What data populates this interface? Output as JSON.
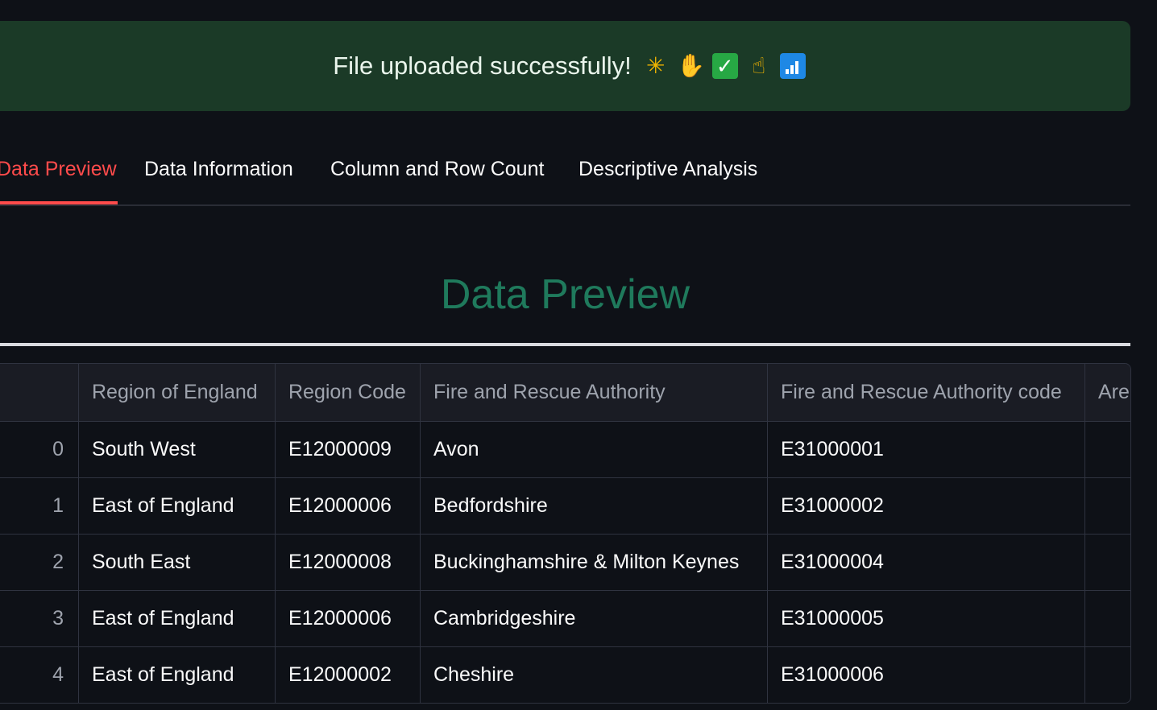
{
  "banner": {
    "message": "File uploaded successfully!",
    "emojis": [
      "party-popper-icon",
      "raising-hands-icon",
      "check-mark-icon",
      "thumbs-up-icon",
      "signal-bars-icon"
    ]
  },
  "tabs": [
    {
      "label": "Data Preview",
      "active": true
    },
    {
      "label": "Data Information",
      "active": false
    },
    {
      "label": "Column and Row Count",
      "active": false
    },
    {
      "label": "Descriptive Analysis",
      "active": false
    }
  ],
  "section": {
    "title": "Data Preview"
  },
  "table": {
    "columns": [
      "",
      "Region of England",
      "Region Code",
      "Fire and Rescue Authority",
      "Fire and Rescue Authority code",
      "Are"
    ],
    "rows": [
      {
        "index": "0",
        "region": "South West",
        "region_code": "E12000009",
        "authority": "Avon",
        "authority_code": "E31000001",
        "extra": ""
      },
      {
        "index": "1",
        "region": "East of England",
        "region_code": "E12000006",
        "authority": "Bedfordshire",
        "authority_code": "E31000002",
        "extra": ""
      },
      {
        "index": "2",
        "region": "South East",
        "region_code": "E12000008",
        "authority": "Buckinghamshire & Milton Keynes",
        "authority_code": "E31000004",
        "extra": ""
      },
      {
        "index": "3",
        "region": "East of England",
        "region_code": "E12000006",
        "authority": "Cambridgeshire",
        "authority_code": "E31000005",
        "extra": ""
      },
      {
        "index": "4",
        "region": "East of England",
        "region_code": "E12000002",
        "authority": "Cheshire",
        "authority_code": "E31000006",
        "extra": ""
      }
    ]
  },
  "colors": {
    "background": "#0e1117",
    "banner": "#1b3a27",
    "accent": "#ff4b4b",
    "heading": "#1f7a5c"
  }
}
